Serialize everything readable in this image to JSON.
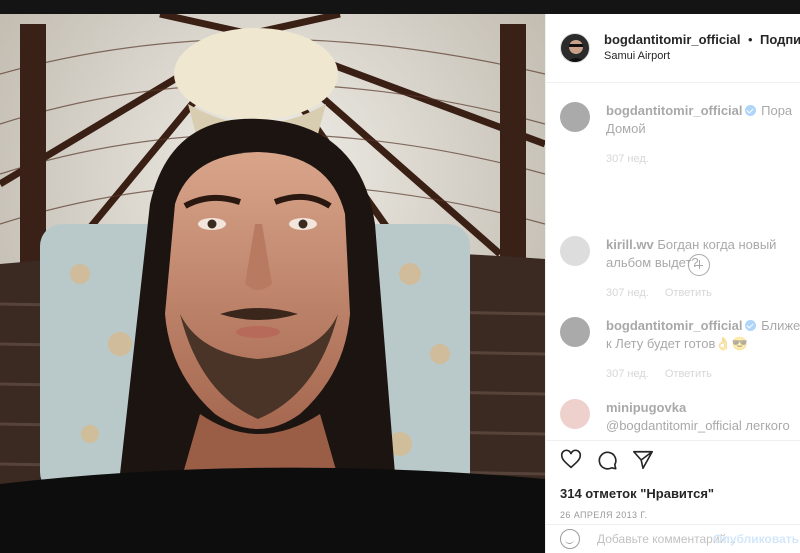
{
  "post": {
    "author": "bogdantitomir_official",
    "separator": "•",
    "follow_label": "Подписки",
    "location": "Samui Airport"
  },
  "comments": [
    {
      "username": "bogdantitomir_official",
      "verified": true,
      "text": "Пора Домой",
      "time": "307 нед.",
      "reply_label": ""
    },
    {
      "username": "kirill.wv",
      "verified": false,
      "text": "Богдан когда новый альбом выдет?",
      "time": "307 нед.",
      "reply_label": "Ответить"
    },
    {
      "username": "bogdantitomir_official",
      "verified": true,
      "text": "Ближе к Лету будет готов👌😎",
      "time": "307 нед.",
      "reply_label": "Ответить"
    },
    {
      "username": "minipugovka",
      "verified": false,
      "text": "@bogdantitomir_official легкого",
      "time": "",
      "reply_label": ""
    }
  ],
  "likes": "314 отметок \"Нравится\"",
  "date": "26 АПРЕЛЯ 2013 Г.",
  "add_comment": {
    "placeholder": "Добавьте комментарий...",
    "post_label": "Опубликовать"
  },
  "icons": [
    "heart-icon",
    "comment-icon",
    "share-icon",
    "emoji-icon",
    "load-more-icon"
  ],
  "colors": {
    "verified": "#3897f0",
    "muted": "#999999",
    "text": "#262626"
  }
}
